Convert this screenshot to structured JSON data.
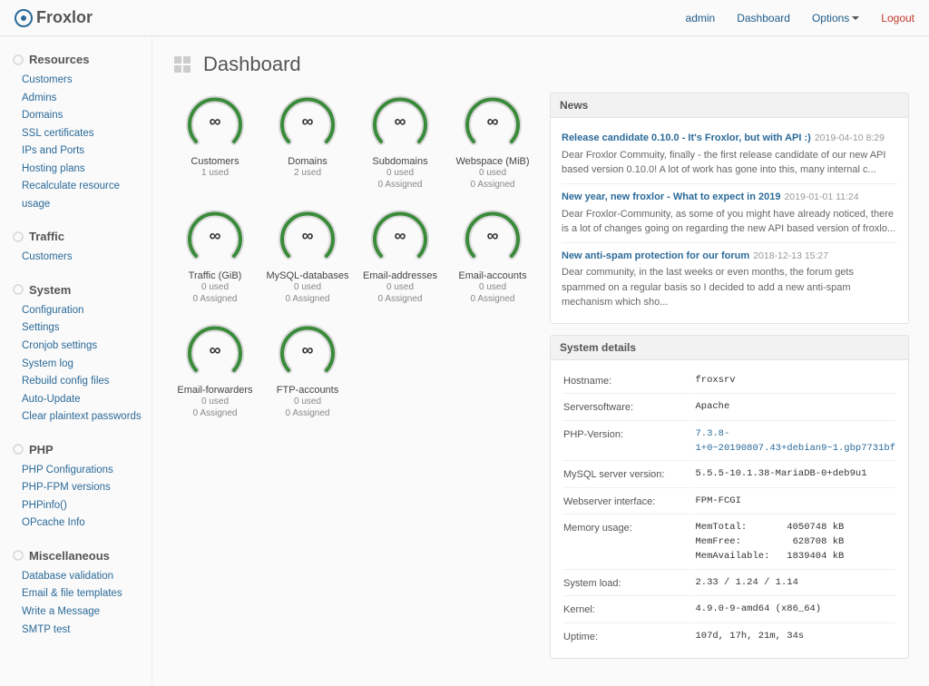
{
  "brand": "Froxlor",
  "topnav": {
    "user": "admin",
    "dashboard": "Dashboard",
    "options": "Options",
    "logout": "Logout"
  },
  "page": {
    "title": "Dashboard"
  },
  "sidebar": [
    {
      "title": "Resources",
      "items": [
        "Customers",
        "Admins",
        "Domains",
        "SSL certificates",
        "IPs and Ports",
        "Hosting plans",
        "Recalculate resource usage"
      ]
    },
    {
      "title": "Traffic",
      "items": [
        "Customers"
      ]
    },
    {
      "title": "System",
      "items": [
        "Configuration",
        "Settings",
        "Cronjob settings",
        "System log",
        "Rebuild config files",
        "Auto-Update",
        "Clear plaintext passwords"
      ]
    },
    {
      "title": "PHP",
      "items": [
        "PHP Configurations",
        "PHP-FPM versions",
        "PHPinfo()",
        "OPcache Info"
      ]
    },
    {
      "title": "Miscellaneous",
      "items": [
        "Database validation",
        "Email & file templates",
        "Write a Message",
        "SMTP test"
      ]
    }
  ],
  "gauges": [
    {
      "label": "Customers",
      "l1": "1 used",
      "l2": ""
    },
    {
      "label": "Domains",
      "l1": "2 used",
      "l2": ""
    },
    {
      "label": "Subdomains",
      "l1": "0 used",
      "l2": "0 Assigned"
    },
    {
      "label": "Webspace (MiB)",
      "l1": "0 used",
      "l2": "0 Assigned"
    },
    {
      "label": "Traffic (GiB)",
      "l1": "0 used",
      "l2": "0 Assigned"
    },
    {
      "label": "MySQL-databases",
      "l1": "0 used",
      "l2": "0 Assigned"
    },
    {
      "label": "Email-addresses",
      "l1": "0 used",
      "l2": "0 Assigned"
    },
    {
      "label": "Email-accounts",
      "l1": "0 used",
      "l2": "0 Assigned"
    },
    {
      "label": "Email-forwarders",
      "l1": "0 used",
      "l2": "0 Assigned"
    },
    {
      "label": "FTP-accounts",
      "l1": "0 used",
      "l2": "0 Assigned"
    }
  ],
  "news_header": "News",
  "news": [
    {
      "title": "Release candidate 0.10.0 - It's Froxlor, but with API :)",
      "date": "2019-04-10 8:29",
      "text": "Dear Froxlor Commuity, finally - the first release candidate of our new API based version 0.10.0! A lot of work has gone into this, many internal c..."
    },
    {
      "title": "New year, new froxlor - What to expect in 2019",
      "date": "2019-01-01 11:24",
      "text": "Dear Froxlor-Community, as some of you might have already noticed, there is a lot of changes going on regarding the new API based version of froxlo..."
    },
    {
      "title": "New anti-spam protection for our forum",
      "date": "2018-12-13 15:27",
      "text": "Dear community, in the last weeks or even months, the forum gets spammed on a regular basis so I decided to add a new anti-spam mechanism which sho..."
    }
  ],
  "details_header": "System details",
  "details": {
    "hostname_k": "Hostname:",
    "hostname_v": "froxsrv",
    "server_k": "Serversoftware:",
    "server_v": "Apache",
    "php_k": "PHP-Version:",
    "php_v": "7.3.8-1+0~20190807.43+debian9~1.gbp7731bf",
    "mysql_k": "MySQL server version:",
    "mysql_v": "5.5.5-10.1.38-MariaDB-0+deb9u1",
    "web_k": "Webserver interface:",
    "web_v": "FPM-FCGI",
    "mem_k": "Memory usage:",
    "mem_v": "MemTotal:       4050748 kB\nMemFree:         628708 kB\nMemAvailable:   1839404 kB",
    "load_k": "System load:",
    "load_v": "2.33 / 1.24 / 1.14",
    "kernel_k": "Kernel:",
    "kernel_v": "4.9.0-9-amd64 (x86_64)",
    "uptime_k": "Uptime:",
    "uptime_v": "107d, 17h, 21m, 34s"
  }
}
